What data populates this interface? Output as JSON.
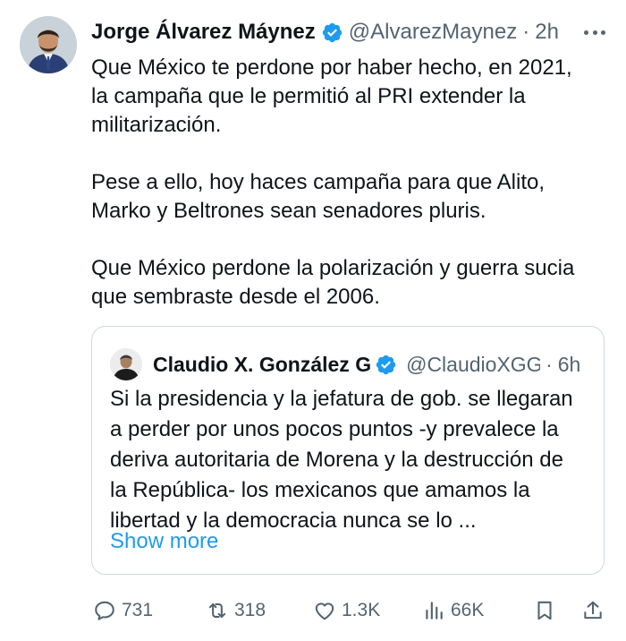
{
  "author": {
    "name": "Jorge Álvarez Máynez",
    "handle": "@AlvarezMaynez",
    "separator": "·",
    "time": "2h"
  },
  "tweet_text": {
    "p1": [
      "Que México te perdone por haber hecho, en 2021,",
      "la campaña que le permitió al PRI extender la",
      "militarización."
    ],
    "p2": [
      "Pese a ello, hoy haces campaña para que Alito,",
      "Marko y Beltrones sean senadores pluris."
    ],
    "p3": [
      "Que México perdone la polarización y guerra sucia",
      "que sembraste desde el 2006."
    ]
  },
  "quoted": {
    "name": "Claudio X. González G",
    "handle": "@ClaudioXGG",
    "separator": "·",
    "time": "6h",
    "text": [
      "Si la presidencia y la jefatura de gob. se llegaran",
      "a perder por unos pocos puntos -y prevalece la",
      "deriva autoritaria de Morena y la destrucción de",
      "la República- los mexicanos que amamos la",
      "libertad y la democracia nunca se lo ..."
    ],
    "show_more": "Show more"
  },
  "actions": {
    "replies": "731",
    "reposts": "318",
    "likes": "1.3K",
    "views": "66K"
  },
  "icons": [
    "verified-badge-icon",
    "more-options-icon",
    "reply-icon",
    "retweet-icon",
    "like-icon",
    "views-icon",
    "bookmark-icon",
    "share-icon"
  ],
  "colors": {
    "text": "#0f1419",
    "secondary": "#536471",
    "link": "#1d9bf0",
    "verified": "#1d9bf0",
    "border": "#cfd9de"
  }
}
